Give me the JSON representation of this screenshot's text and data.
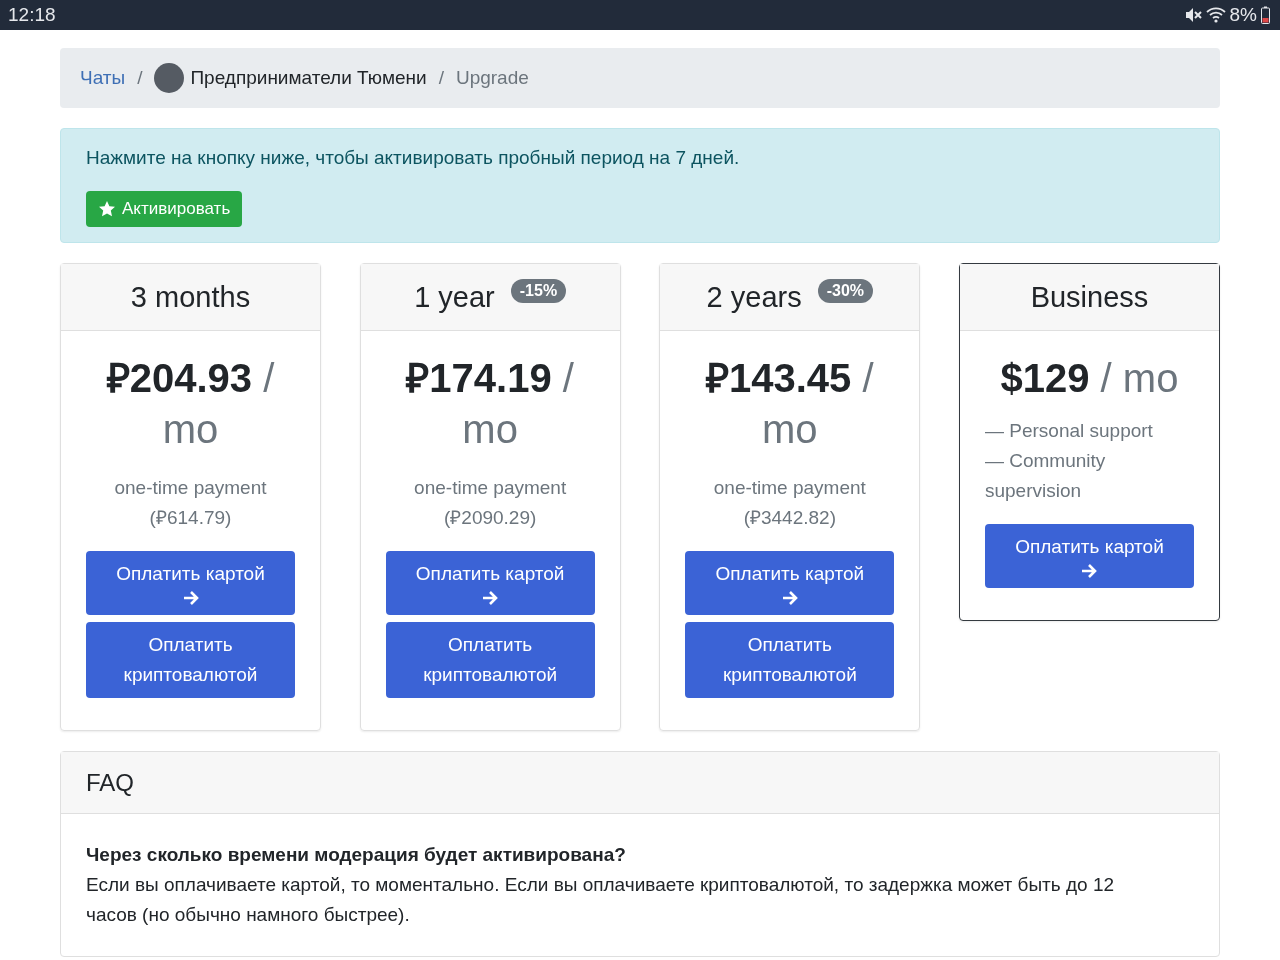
{
  "status_bar": {
    "time": "12:18",
    "battery": "8%"
  },
  "breadcrumb_separator": "/",
  "breadcrumb": [
    {
      "kind": "link",
      "label": "Чаты"
    },
    {
      "kind": "group",
      "label": "Предприниматели Тюмени"
    },
    {
      "kind": "current",
      "label": "Upgrade"
    }
  ],
  "alert": {
    "text": "Нажмите на кнопку ниже, чтобы активировать пробный период на 7 дней.",
    "button": "Активировать"
  },
  "plans": [
    {
      "kind": "plan",
      "featured": false,
      "title": "3 months",
      "price": "**₽204.93** / mo",
      "note": "one-time payment (₽614.79)",
      "buttons": [
        {
          "kind": "card",
          "label": "Оплатить картой"
        },
        {
          "kind": "crypto",
          "label": "Оплатить криптовалютой"
        }
      ]
    },
    {
      "kind": "plan",
      "featured": false,
      "title": "1 year",
      "badge": "-15%",
      "price": "**₽174.19** / mo",
      "note": "one-time payment (₽2090.29)",
      "buttons": [
        {
          "kind": "card",
          "label": "Оплатить картой"
        },
        {
          "kind": "crypto",
          "label": "Оплатить криптовалютой"
        }
      ]
    },
    {
      "kind": "plan",
      "featured": false,
      "title": "2 years",
      "badge": "-30%",
      "price": "**₽143.45** / mo",
      "note": "one-time payment (₽3442.82)",
      "buttons": [
        {
          "kind": "card",
          "label": "Оплатить картой"
        },
        {
          "kind": "crypto",
          "label": "Оплатить криптовалютой"
        }
      ]
    },
    {
      "kind": "business",
      "featured": true,
      "title": "Business",
      "price": "**$129** / mo",
      "features": [
        "— Personal support",
        "— Community supervision"
      ],
      "buttons": [
        {
          "kind": "card",
          "label": "Оплатить картой"
        }
      ]
    }
  ],
  "faq": {
    "title": "FAQ",
    "items": [
      {
        "question": "Через сколько времени модерация будет активирована?",
        "answer": "Если вы оплачиваете картой, то моментально. Если вы оплачиваете криптовалютой, то задержка может быть до 12 часов (но обычно намного быстрее)."
      }
    ]
  }
}
